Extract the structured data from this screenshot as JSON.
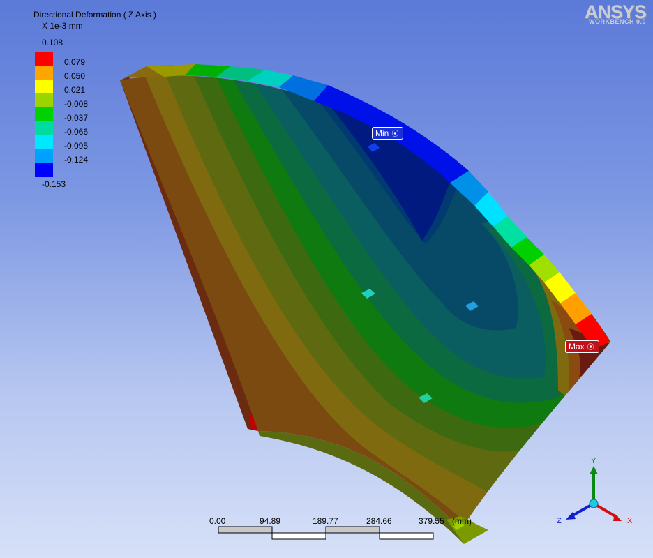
{
  "result": {
    "title": "Directional Deformation ( Z Axis )",
    "units": "X 1e-3 mm",
    "max_value": "0.108",
    "min_value": "-0.153"
  },
  "legend": [
    {
      "value": "0.079",
      "color": "#ff0000"
    },
    {
      "value": "0.050",
      "color": "#ffa500"
    },
    {
      "value": "0.021",
      "color": "#ffff00"
    },
    {
      "value": "-0.008",
      "color": "#9cd400"
    },
    {
      "value": "-0.037",
      "color": "#00d200"
    },
    {
      "value": "-0.066",
      "color": "#00dca0"
    },
    {
      "value": "-0.095",
      "color": "#00e8ff"
    },
    {
      "value": "-0.124",
      "color": "#00a0ff"
    },
    {
      "value": "",
      "color": "#0000ff"
    }
  ],
  "brand": {
    "name": "ANSYS",
    "sub": "WORKBENCH 9.0"
  },
  "probes": {
    "min_label": "Min",
    "max_label": "Max"
  },
  "scale_bar": {
    "ticks": [
      "0.00",
      "94.89",
      "189.77",
      "284.66",
      "379.55"
    ],
    "unit": "(mm)"
  },
  "triad": {
    "x": "X",
    "y": "Y",
    "z": "Z"
  }
}
